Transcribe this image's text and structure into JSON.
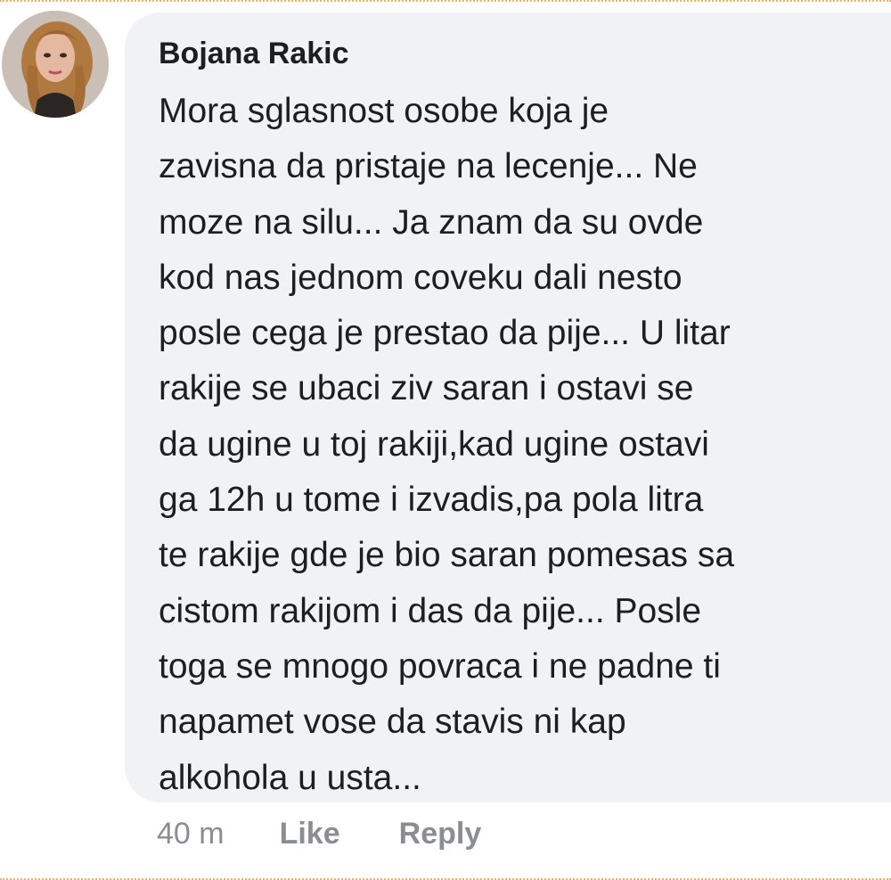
{
  "comment": {
    "author": "Bojana Rakic",
    "lines": [
      "Mora sglasnost osobe koja je",
      "zavisna da pristaje na lecenje... Ne",
      "moze na silu... Ja znam da su ovde",
      "kod nas jednom coveku dali nesto",
      "posle cega je prestao da pije... U litar",
      "rakije se ubaci ziv saran i ostavi se",
      "da ugine u toj rakiji,kad ugine ostavi",
      "ga 12h u tome i izvadis,pa pola litra",
      "te rakije gde je bio saran pomesas sa",
      "cistom rakijom i das da pije... Posle",
      "toga se mnogo povraca i ne padne ti",
      "napamet vose da stavis ni kap",
      "alkohola u usta..."
    ],
    "timestamp": "40 m",
    "like_label": "Like",
    "reply_label": "Reply"
  },
  "colors": {
    "bubble_bg": "#f0f2f5",
    "text": "#1c1e21",
    "meta": "#8a8d91",
    "border_dots": "#e8b46a"
  }
}
